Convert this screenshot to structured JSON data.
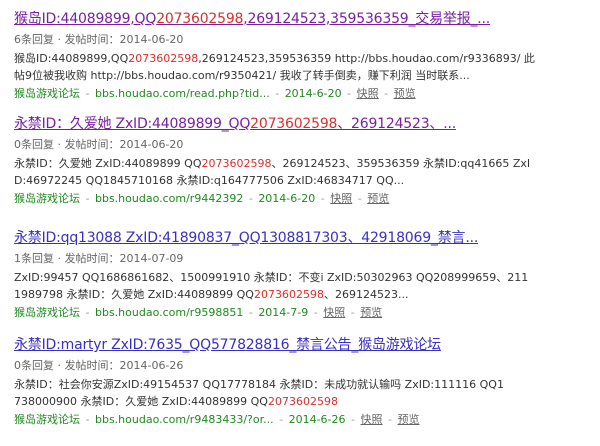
{
  "results": [
    {
      "title_pre": "猴岛ID:44089899,QQ",
      "title_hl": "2073602598",
      "title_post": ",269124523,359536359_交易举报_...",
      "meta": "6条回复 · 发帖时间：2014-06-20",
      "snippet_l1_pre": "猴岛ID:44089899,QQ",
      "snippet_l1_hl": "2073602598",
      "snippet_l1_post": ",269124523,359536359 http://bbs.houdao.com/r9336893/ 此",
      "snippet_l2": "帖9位被我收购 http://bbs.houdao.com/r9350421/ 我收了转手倒卖，赚下利润 当时联系...",
      "source": "猴岛游戏论坛",
      "url": "bbs.houdao.com/read.php?tid...",
      "date": "2014-6-20",
      "cache": "快照",
      "preview": "预览"
    },
    {
      "title_pre": "永禁ID：久爱她 ZxID:44089899_QQ",
      "title_hl": "2073602598",
      "title_post": "、269124523、...",
      "meta": "0条回复 · 发帖时间：2014-06-20",
      "snippet_l1_pre": "永禁ID：久爱她 ZxID:44089899  QQ",
      "snippet_l1_hl": "2073602598",
      "snippet_l1_post": "、269124523、359536359 永禁ID:qq41665 ZxI",
      "snippet_l2": "D:46972245  QQ1845710168 永禁ID:q164777506 ZxID:46834717  QQ...",
      "source": "猴岛游戏论坛",
      "url": "bbs.houdao.com/r9442392",
      "date": "2014-6-20",
      "cache": "快照",
      "preview": "预览"
    },
    {
      "title": "永禁ID:qq13088 ZxID:41890837_QQ1308817303、42918069_禁言...",
      "meta": "1条回复 · 发帖时间：2014-07-09",
      "snippet_l1": "ZxID:99457  QQ1686861682、1500991910 永禁ID：不变i ZxID:50302963  QQ208999659、211",
      "snippet_l2_pre": "1989798 永禁ID：久爱她 ZxID:44089899  QQ",
      "snippet_l2_hl": "2073602598",
      "snippet_l2_post": "、269124523...",
      "source": "猴岛游戏论坛",
      "url": "bbs.houdao.com/r9598851",
      "date": "2014-7-9",
      "cache": "快照",
      "preview": "预览"
    },
    {
      "title": "永禁ID:martyr ZxID:7635_QQ577828816_禁言公告_猴岛游戏论坛",
      "meta": "0条回复 · 发帖时间：2014-06-26",
      "snippet_l1": "永禁ID：社会你安源ZxID:49154537  QQ17778184 永禁ID：未成功就认输吗 ZxID:111116  QQ1",
      "snippet_l2_pre": "738000900 永禁ID：久爱她 ZxID:44089899  QQ",
      "snippet_l2_hl": "2073602598",
      "snippet_l2_post": "",
      "source": "猴岛游戏论坛",
      "url": "bbs.houdao.com/r9483433/?or...",
      "date": "2014-6-26",
      "cache": "快照",
      "preview": "预览"
    }
  ]
}
